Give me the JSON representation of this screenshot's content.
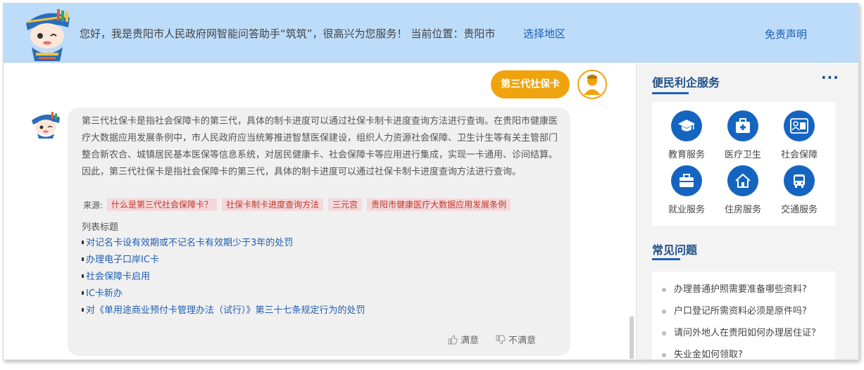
{
  "header": {
    "greeting": "您好，我是贵阳市人民政府网智能问答助手“筑筑”，很高兴为您服务！ 当前位置：贵阳市",
    "region_link": "选择地区",
    "disclaimer": "免责声明"
  },
  "chat": {
    "user_question": "第三代社保卡",
    "answer_text": "第三代社保卡是指社会保障卡的第三代，具体的制卡进度可以通过社保卡制卡进度查询方法进行查询。在贵阳市健康医疗大数据应用发展条例中，市人民政府应当统筹推进智慧医保建设，组织人力资源社会保障、卫生计生等有关主管部门整合新农合、城镇居民基本医保等信息系统，对居民健康卡、社会保障卡等应用进行集成，实现一卡通用、诊间结算。因此，第三代社保卡是指社会保障卡的第三代，具体的制卡进度可以通过社保卡制卡进度查询方法进行查询。",
    "sources_label": "来源:",
    "sources": [
      "什么是第三代社会保障卡？",
      "社保卡制卡进度查询方法",
      "三元宫",
      "贵阳市健康医疗大数据应用发展条例"
    ],
    "list_title": "列表标题",
    "related": [
      "对记名卡设有效期或不记名卡有效期少于3年的处罚",
      "办理电子口岸IC卡",
      "社会保障卡启用",
      "IC卡新办",
      "对《单用途商业预付卡管理办法（试行）》第三十七条规定行为的处罚"
    ],
    "feedback": {
      "satisfied": "满意",
      "unsatisfied": "不满意"
    }
  },
  "sidebar": {
    "services_title": "便民利企服务",
    "more": "···",
    "services": [
      {
        "label": "教育服务",
        "icon": "graduation-cap-icon"
      },
      {
        "label": "医疗卫生",
        "icon": "medical-kit-icon"
      },
      {
        "label": "社会保障",
        "icon": "social-security-card-icon"
      },
      {
        "label": "就业服务",
        "icon": "briefcase-icon"
      },
      {
        "label": "住房服务",
        "icon": "house-icon"
      },
      {
        "label": "交通服务",
        "icon": "bus-icon"
      }
    ],
    "faq_title": "常见问题",
    "faq": [
      "办理普通护照需要准备哪些资料?",
      "户口登记所需资料必须是原件吗?",
      "请问外地人在贵阳如何办理居住证？",
      "失业金如何领取?"
    ]
  },
  "colors": {
    "header_bg": "#bcdcfa",
    "link": "#1f5fb4",
    "user_bubble": "#efa30c",
    "service_icon": "#1565c0",
    "source_tag_bg": "#f3d9dc",
    "source_tag_text": "#c0392b"
  }
}
